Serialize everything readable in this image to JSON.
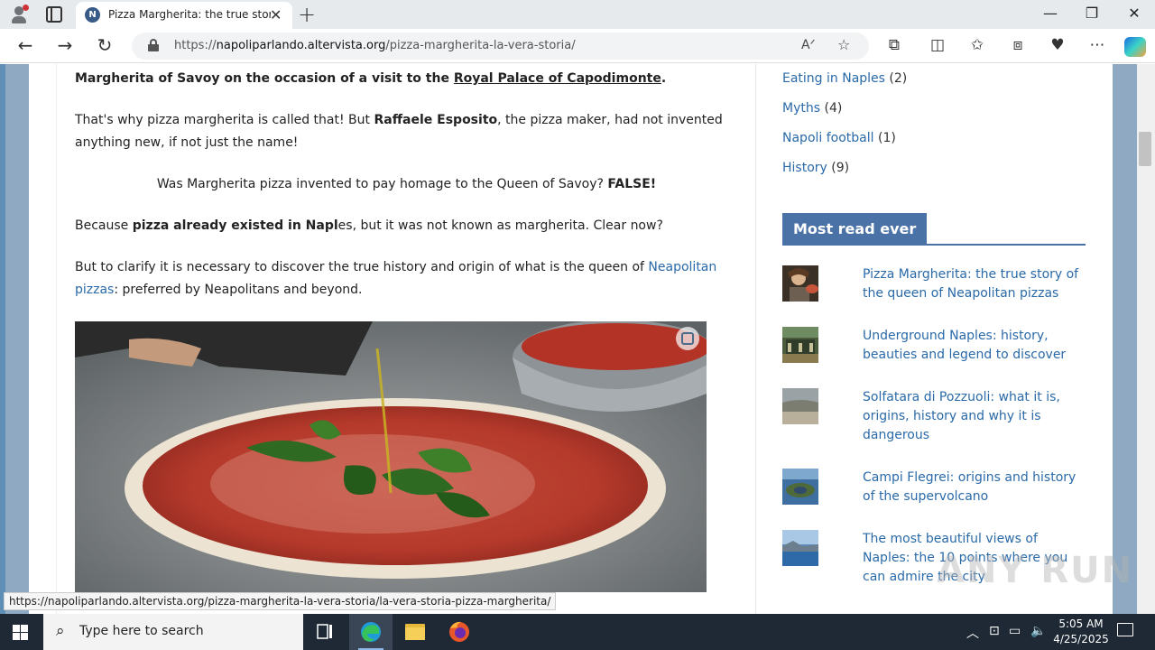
{
  "browser": {
    "tab_title": "Pizza Margherita: the true story of the queen of Neapolitan pizzas",
    "tab_favicon_letter": "N",
    "url_prefix": "https://",
    "url_domain": "napoliparlando.altervista.org",
    "url_path": "/pizza-margherita-la-vera-storia/",
    "status_url": "https://napoliparlando.altervista.org/pizza-margherita-la-vera-storia/la-vera-storia-pizza-margherita/"
  },
  "article": {
    "p1_before": "Margherita of Savoy on the occasion of a visit to the ",
    "p1_link": "Royal Palace of Capodimonte",
    "p1_after": ".",
    "p2_before": "That's why pizza margherita is called that! But ",
    "p2_bold": "Raffaele Esposito",
    "p2_after": ", the pizza maker, had not invented anything new, if not just the name!",
    "p3_text": "Was Margherita pizza invented to pay homage to the Queen of Savoy? ",
    "p3_bold": "FALSE!",
    "p4_before": "Because ",
    "p4_bold": "pizza already existed in Napl",
    "p4_after": "es, but it was not known as margherita. Clear now?",
    "p5_before": "But to clarify it is necessary to discover the true history and origin of what is the queen of ",
    "p5_link": "Neapolitan pizzas",
    "p5_after": ": preferred by Neapolitans and beyond."
  },
  "sidebar": {
    "categories": [
      {
        "label": "Eating in Naples",
        "count": "(2)"
      },
      {
        "label": "Myths",
        "count": "(4)"
      },
      {
        "label": "Napoli football",
        "count": "(1)"
      },
      {
        "label": "History",
        "count": "(9)"
      }
    ],
    "most_read_heading": "Most read ever",
    "most_read": [
      {
        "title": "Pizza Margherita: the true story of the queen of Neapolitan pizzas"
      },
      {
        "title": "Underground Naples: history, beauties and legend to discover"
      },
      {
        "title": "Solfatara di Pozzuoli: what it is, origins, history and why it is dangerous"
      },
      {
        "title": "Campi Flegrei: origins and history of the supervolcano"
      },
      {
        "title": "The most beautiful views of Naples: the 10 points where you can admire the city"
      }
    ]
  },
  "watermark": "ANY RUN",
  "taskbar": {
    "search_placeholder": "Type here to search",
    "time": "5:05 AM",
    "date": "4/25/2025"
  },
  "colors": {
    "link": "#2a6aa8",
    "heading_bg": "#4a72a6",
    "page_bg": "#8ea9c1",
    "taskbar": "#1f2835"
  }
}
